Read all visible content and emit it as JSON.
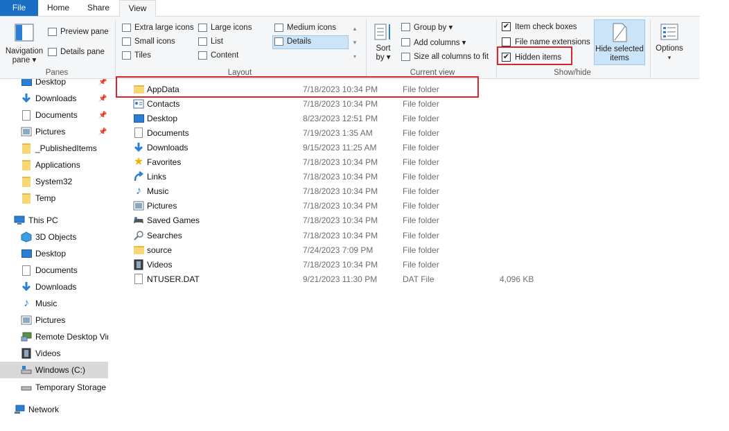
{
  "ribbon_tabs": {
    "file": "File",
    "home": "Home",
    "share": "Share",
    "view": "View"
  },
  "panes": {
    "navigation_pane": "Navigation pane",
    "navigation_pane_l1": "Navigation",
    "navigation_pane_l2": "pane ▾",
    "preview_pane": "Preview pane",
    "details_pane": "Details pane",
    "group_title": "Panes"
  },
  "layout": {
    "options": [
      "Extra large icons",
      "Large icons",
      "Medium icons",
      "Small icons",
      "List",
      "Details",
      "Tiles",
      "Content"
    ],
    "selected": "Details",
    "group_title": "Layout"
  },
  "current_view": {
    "sort_by_l1": "Sort",
    "sort_by_l2": "by ▾",
    "group_by": "Group by ▾",
    "add_columns": "Add columns ▾",
    "size_all_columns": "Size all columns to fit",
    "group_title": "Current view"
  },
  "show_hide": {
    "item_check_boxes": "Item check boxes",
    "item_check_boxes_checked": true,
    "file_name_extensions": "File name extensions",
    "file_name_extensions_checked": false,
    "hidden_items": "Hidden items",
    "hidden_items_checked": true,
    "hide_selected_l1": "Hide selected",
    "hide_selected_l2": "items",
    "options": "Options",
    "options_arrow": "▾",
    "group_title": "Show/hide"
  },
  "nav_pane": {
    "quick_access": [
      {
        "label": "Desktop",
        "icon": "desktop-icon",
        "pinned": true
      },
      {
        "label": "Downloads",
        "icon": "downloads-icon",
        "pinned": true
      },
      {
        "label": "Documents",
        "icon": "documents-icon",
        "pinned": true
      },
      {
        "label": "Pictures",
        "icon": "pictures-icon",
        "pinned": true
      },
      {
        "label": "_PublishedItems",
        "icon": "folder-icon",
        "pinned": false
      },
      {
        "label": "Applications",
        "icon": "folder-icon",
        "pinned": false
      },
      {
        "label": "System32",
        "icon": "folder-icon",
        "pinned": false
      },
      {
        "label": "Temp",
        "icon": "folder-icon",
        "pinned": false
      }
    ],
    "this_pc": "This PC",
    "this_pc_items": [
      {
        "label": "3D Objects",
        "icon": "3d-objects-icon"
      },
      {
        "label": "Desktop",
        "icon": "desktop-icon"
      },
      {
        "label": "Documents",
        "icon": "documents-icon"
      },
      {
        "label": "Downloads",
        "icon": "downloads-icon"
      },
      {
        "label": "Music",
        "icon": "music-icon"
      },
      {
        "label": "Pictures",
        "icon": "pictures-icon"
      },
      {
        "label": "Remote Desktop Vir",
        "icon": "remote-desktop-icon"
      },
      {
        "label": "Videos",
        "icon": "videos-icon"
      },
      {
        "label": "Windows (C:)",
        "icon": "drive-icon",
        "selected": true
      },
      {
        "label": "Temporary Storage",
        "icon": "drive-icon"
      }
    ],
    "network": "Network"
  },
  "files": [
    {
      "name": "AppData",
      "date": "7/18/2023 10:34 PM",
      "type": "File folder",
      "size": "",
      "icon": "folder-icon"
    },
    {
      "name": "Contacts",
      "date": "7/18/2023 10:34 PM",
      "type": "File folder",
      "size": "",
      "icon": "contacts-icon"
    },
    {
      "name": "Desktop",
      "date": "8/23/2023 12:51 PM",
      "type": "File folder",
      "size": "",
      "icon": "desktop-icon"
    },
    {
      "name": "Documents",
      "date": "7/19/2023 1:35 AM",
      "type": "File folder",
      "size": "",
      "icon": "documents-icon"
    },
    {
      "name": "Downloads",
      "date": "9/15/2023 11:25 AM",
      "type": "File folder",
      "size": "",
      "icon": "downloads-icon"
    },
    {
      "name": "Favorites",
      "date": "7/18/2023 10:34 PM",
      "type": "File folder",
      "size": "",
      "icon": "favorites-icon"
    },
    {
      "name": "Links",
      "date": "7/18/2023 10:34 PM",
      "type": "File folder",
      "size": "",
      "icon": "links-icon"
    },
    {
      "name": "Music",
      "date": "7/18/2023 10:34 PM",
      "type": "File folder",
      "size": "",
      "icon": "music-icon"
    },
    {
      "name": "Pictures",
      "date": "7/18/2023 10:34 PM",
      "type": "File folder",
      "size": "",
      "icon": "pictures-icon"
    },
    {
      "name": "Saved Games",
      "date": "7/18/2023 10:34 PM",
      "type": "File folder",
      "size": "",
      "icon": "saved-games-icon"
    },
    {
      "name": "Searches",
      "date": "7/18/2023 10:34 PM",
      "type": "File folder",
      "size": "",
      "icon": "searches-icon"
    },
    {
      "name": "source",
      "date": "7/24/2023 7:09 PM",
      "type": "File folder",
      "size": "",
      "icon": "folder-icon"
    },
    {
      "name": "Videos",
      "date": "7/18/2023 10:34 PM",
      "type": "File folder",
      "size": "",
      "icon": "videos-icon"
    },
    {
      "name": "NTUSER.DAT",
      "date": "9/21/2023 11:30 PM",
      "type": "DAT File",
      "size": "4,096 KB",
      "icon": "file-icon"
    }
  ],
  "colors": {
    "accent": "#1a6fc4",
    "highlight_red": "#d9252d",
    "selection": "#cce4f7"
  }
}
